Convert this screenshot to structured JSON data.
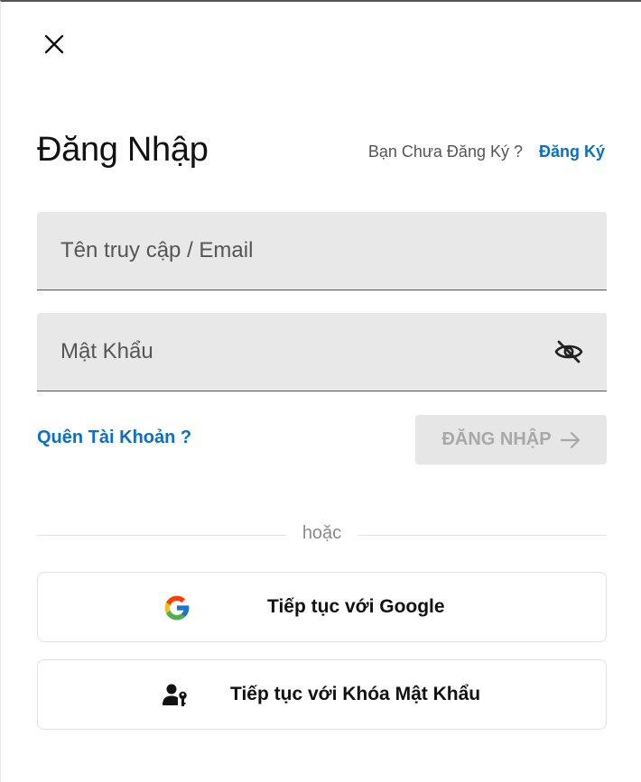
{
  "dialog": {
    "title": "Đăng Nhập",
    "signup_prompt": "Bạn Chưa Đăng Ký ?",
    "signup_link": "Đăng Ký"
  },
  "form": {
    "username_placeholder": "Tên truy cập / Email",
    "username_value": "",
    "password_placeholder": "Mật Khẩu",
    "password_value": "",
    "forgot_link": "Quên Tài Khoản ?",
    "login_button": "ĐĂNG NHẬP",
    "login_enabled": false
  },
  "divider_text": "hoặc",
  "social": {
    "google_label": "Tiếp tục với Google",
    "passkey_label": "Tiếp tục với Khóa Mật Khẩu"
  },
  "icons": {
    "close": "close-icon",
    "password_toggle": "eye-off-icon",
    "login_arrow": "arrow-right-icon",
    "google": "google-icon",
    "passkey": "passkey-icon"
  },
  "colors": {
    "link": "#0a6fc7",
    "field_bg": "#e8e8e8",
    "disabled_button_bg": "#e6e6e6",
    "disabled_button_text": "#a8a8a8"
  }
}
